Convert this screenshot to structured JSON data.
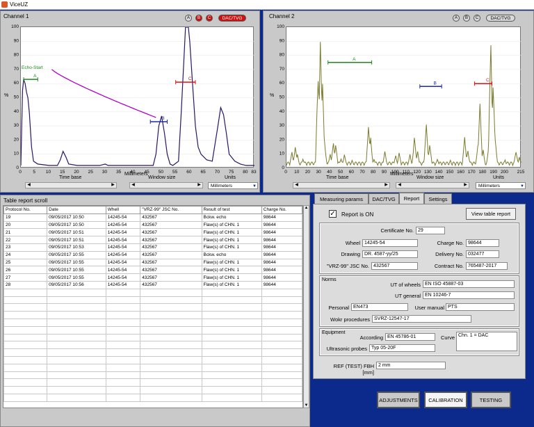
{
  "window": {
    "title": "ViceUZ"
  },
  "channel1": {
    "title": "Channel 1",
    "buttons": [
      "A",
      "B",
      "C"
    ],
    "mode_label": "DAC/TVG",
    "y_ticks": [
      "0",
      "10",
      "20",
      "30",
      "40",
      "50",
      "60",
      "70",
      "80",
      "90",
      "100"
    ],
    "x_ticks": [
      "0",
      "5",
      "10",
      "15",
      "20",
      "25",
      "30",
      "35",
      "40",
      "45",
      "50",
      "55",
      "60",
      "65",
      "70",
      "75",
      "80",
      "83"
    ],
    "y_unit": "%",
    "x_label": "Millimeters",
    "echo_start_label": "Echo-Start",
    "gate_a": "A",
    "gate_b": "B",
    "gate_c": "C",
    "time_base": "Time base",
    "window_size": "Window size",
    "units_label": "Units",
    "units_value": "Millimeters"
  },
  "channel2": {
    "title": "Channel 2",
    "buttons": [
      "A",
      "B",
      "C"
    ],
    "mode_label": "DAC/TVG",
    "y_ticks": [
      "0",
      "10",
      "20",
      "30",
      "40",
      "50",
      "60",
      "70",
      "80",
      "90",
      "100"
    ],
    "x_ticks": [
      "0",
      "10",
      "20",
      "30",
      "40",
      "50",
      "60",
      "70",
      "80",
      "90",
      "100",
      "110",
      "120",
      "130",
      "140",
      "150",
      "160",
      "170",
      "180",
      "190",
      "200",
      "215"
    ],
    "y_unit": "%",
    "x_label": "Millimeters",
    "gate_a": "A",
    "gate_b": "B",
    "gate_c": "C",
    "time_base": "Time base",
    "window_size": "Window size",
    "units_label": "Units",
    "units_value": "Millimeters"
  },
  "colors": {
    "background": "#0b2a8c",
    "panel": "#c9c9c9",
    "ch1_trace": "#2a1466",
    "ch2_trace": "#7b7a2e",
    "dac_curve": "#b000c8",
    "gate_a": "#1a8a1a",
    "gate_b": "#1a2aaa",
    "gate_c": "#dd1111",
    "mode_red": "#cc1111"
  },
  "table_report": {
    "title": "Table report scroll",
    "columns": [
      "Protocol No.",
      "Date",
      "Whell",
      "\"VRZ-99\" JSC No.",
      "Result of test",
      "Charge No."
    ],
    "rows": [
      [
        "19",
        "09/05/2017 10:50",
        "14245-54",
        "432567",
        "Bckw. echo",
        "98644"
      ],
      [
        "20",
        "09/05/2017 10:50",
        "14245-54",
        "432567",
        "Flaw(s) of CHN. 1",
        "98644"
      ],
      [
        "21",
        "09/05/2017 10:51",
        "14245-54",
        "432567",
        "Flaw(s) of CHN. 1",
        "98644"
      ],
      [
        "22",
        "09/05/2017 10:51",
        "14245-54",
        "432567",
        "Flaw(s) of CHN. 1",
        "98644"
      ],
      [
        "23",
        "09/05/2017 10:53",
        "14245-54",
        "432567",
        "Flaw(s) of CHN. 1",
        "98644"
      ],
      [
        "24",
        "09/05/2017 10:55",
        "14245-54",
        "432567",
        "Bckw. echo",
        "98644"
      ],
      [
        "25",
        "09/05/2017 10:55",
        "14245-54",
        "432567",
        "Flaw(s) of CHN. 1",
        "98644"
      ],
      [
        "26",
        "09/05/2017 10:55",
        "14245-54",
        "432567",
        "Flaw(s) of CHN. 1",
        "98644"
      ],
      [
        "27",
        "09/05/2017 10:55",
        "14245-54",
        "432567",
        "Flaw(s) of CHN. 1",
        "98644"
      ],
      [
        "28",
        "09/05/2017 10:56",
        "14245-54",
        "432567",
        "Flaw(s) of CHN. 1",
        "98644"
      ]
    ]
  },
  "tabs": [
    "Measuring params",
    "DAC/TVG",
    "Report",
    "Settings"
  ],
  "report": {
    "report_on": "Report is ON",
    "view_button": "View table report",
    "certificate_label": "Certificate No.",
    "certificate": "29",
    "wheel_label": "Wheel",
    "wheel": "14245-54",
    "charge_label": "Charge No.",
    "charge": "98644",
    "drawing_label": "Drawing",
    "drawing": "DR. 4587-yy/25",
    "delivery_label": "Delivery No.",
    "delivery": "032477",
    "vrz_label": "\"VRZ-99\" JSC No.",
    "vrz": "432567",
    "contract_label": "Contract No.",
    "contract": "765487-2017",
    "norms_title": "Norms",
    "ut_wheels_label": "UT of wheels",
    "ut_wheels": "EN ISO 45887-03",
    "ut_general_label": "UT general",
    "ut_general": "EN 10246-7",
    "personal_label": "Personal",
    "personal": "EN473",
    "user_manual_label": "User manual",
    "user_manual": "PTS",
    "wokr_label": "Wokr procedures",
    "wokr": "SVRZ-12547-17",
    "equipment_title": "Equipment",
    "according_label": "According",
    "according": "EN 45786-01",
    "curve_label": "Curve",
    "curve": "Chn. 1 = DAC",
    "probes_label": "Ultrasonic probes",
    "probes": "Typ 05-20F",
    "ref_label": "REF (TEST) FBH [mm]",
    "ref": "2 mm"
  },
  "bottom_buttons": {
    "adjustments": "ADJUSTMENTS",
    "calibration": "CALIBRATION",
    "testing": "TESTING"
  }
}
